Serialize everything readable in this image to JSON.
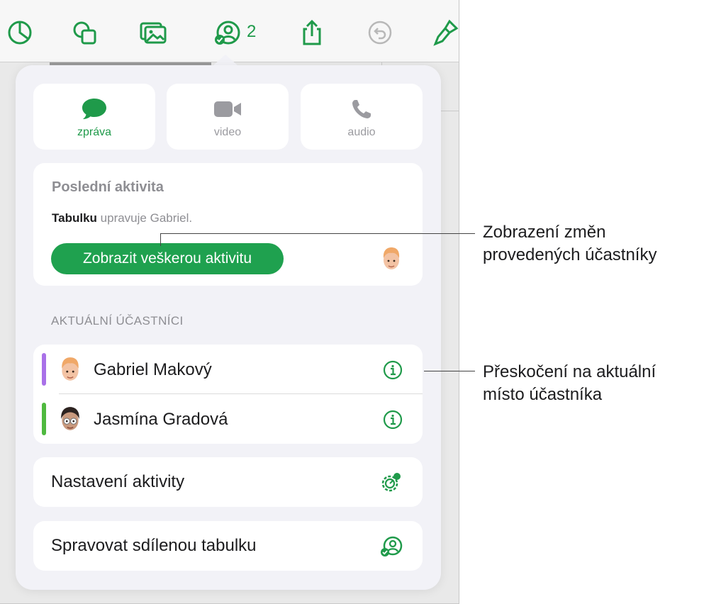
{
  "toolbar": {
    "collaborator_count": "2",
    "buttons": [
      "chart-icon",
      "shapes-icon",
      "media-icon",
      "collaboration-icon",
      "share-icon",
      "undo-icon",
      "format-brush-icon"
    ],
    "accent_color": "#1f9a4a"
  },
  "communication": {
    "message_label": "zpráva",
    "video_label": "video",
    "audio_label": "audio"
  },
  "recent_activity": {
    "heading": "Poslední aktivita",
    "item_bold": "Tabulku",
    "item_text": "upravuje Gabriel.",
    "show_all_label": "Zobrazit veškerou aktivitu"
  },
  "participants": {
    "header": "AKTUÁLNÍ ÚČASTNÍCI",
    "list": [
      {
        "name": "Gabriel Makový",
        "bar_color": "#a971e8"
      },
      {
        "name": "Jasmína Gradová",
        "bar_color": "#4fb93f"
      }
    ]
  },
  "actions": {
    "settings_label": "Nastavení aktivity",
    "manage_label": "Spravovat sdílenou tabulku"
  },
  "callouts": {
    "activity": [
      "Zobrazení změn",
      "provedených účastníky"
    ],
    "location": [
      "Přeskočení na aktuální",
      "místo účastníka"
    ]
  }
}
